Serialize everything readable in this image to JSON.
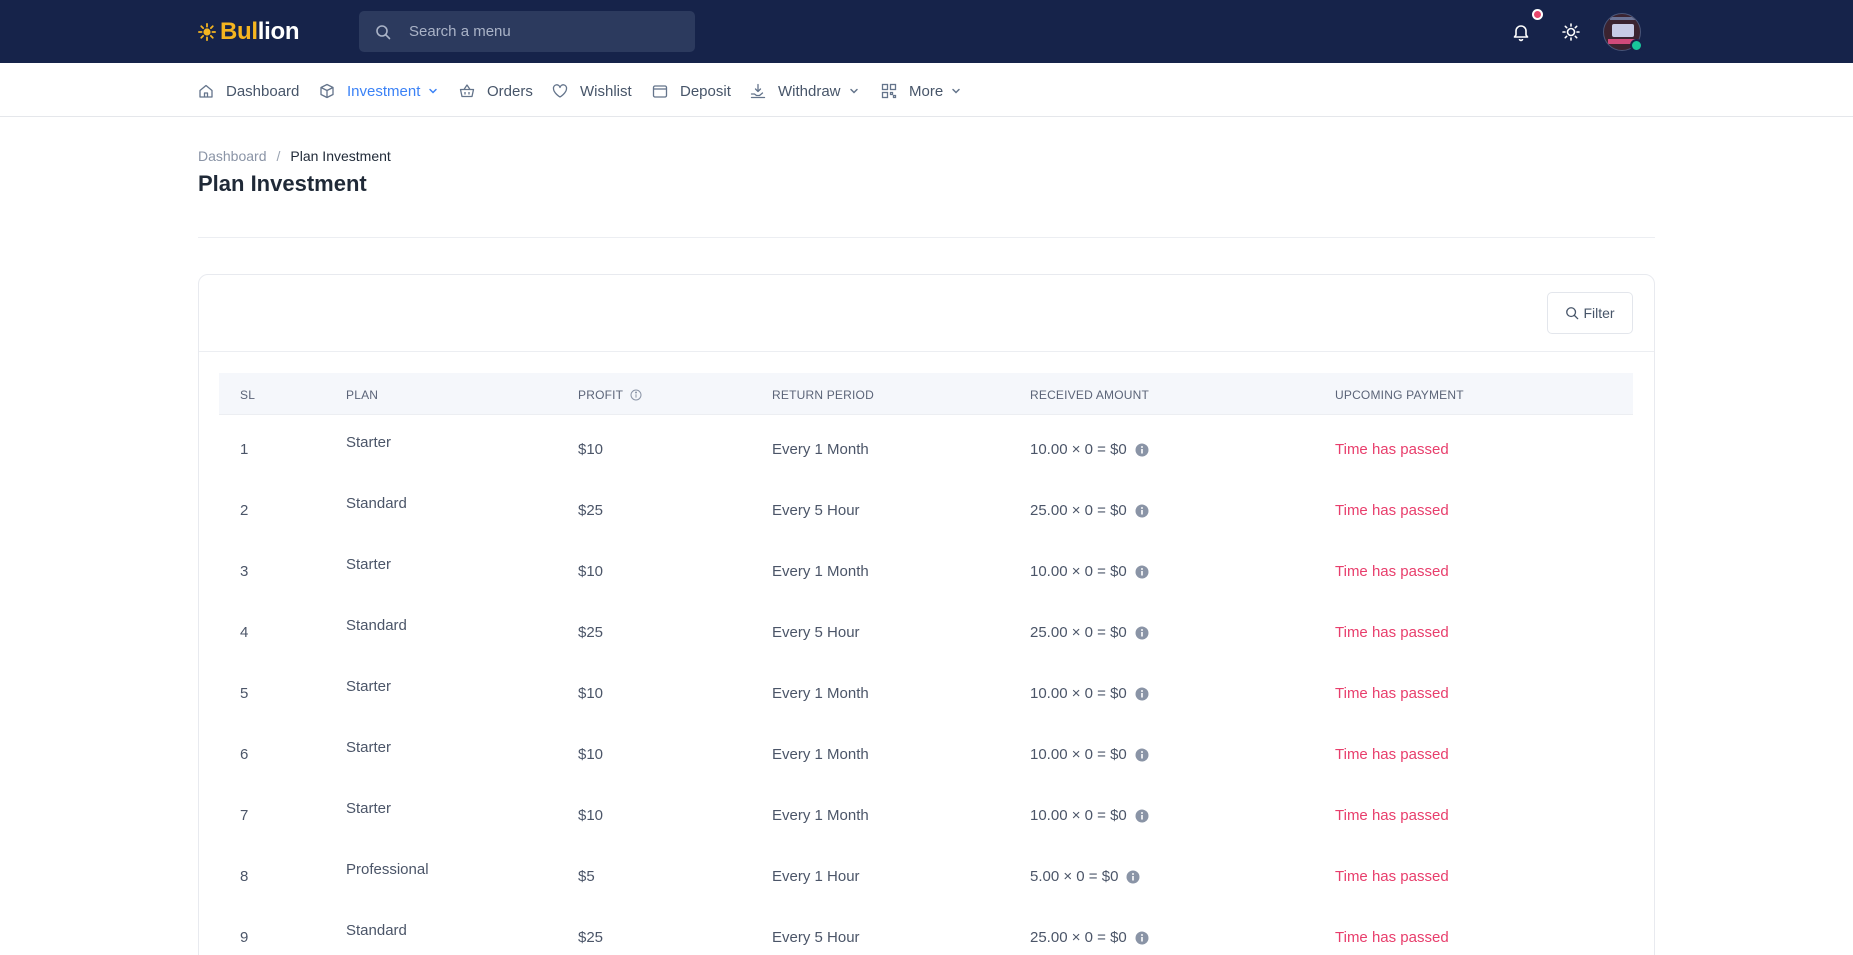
{
  "brand": {
    "part1": "B",
    "part2": "ul",
    "part3": "lion",
    "accent": "#f5b520"
  },
  "search": {
    "placeholder": "Search a menu"
  },
  "nav": {
    "items": [
      {
        "label": "Dashboard",
        "icon": "home-icon"
      },
      {
        "label": "Investment",
        "icon": "cube-icon",
        "active": true,
        "dropdown": true
      },
      {
        "label": "Orders",
        "icon": "basket-icon"
      },
      {
        "label": "Wishlist",
        "icon": "heart-icon"
      },
      {
        "label": "Deposit",
        "icon": "wallet-icon"
      },
      {
        "label": "Withdraw",
        "icon": "withdraw-icon",
        "dropdown": true
      },
      {
        "label": "More",
        "icon": "qr-icon",
        "dropdown": true
      }
    ]
  },
  "breadcrumb": {
    "parent": "Dashboard",
    "separator": "/",
    "current": "Plan Investment"
  },
  "page": {
    "title": "Plan Investment"
  },
  "filter": {
    "label": "Filter"
  },
  "table": {
    "columns": [
      "SL",
      "PLAN",
      "PROFIT",
      "RETURN PERIOD",
      "RECEIVED AMOUNT",
      "UPCOMING PAYMENT"
    ],
    "rows": [
      {
        "sl": "1",
        "plan": "Starter",
        "profit": "$10",
        "period": "Every 1 Month",
        "received": "10.00 × 0 = $0",
        "upcoming": "Time has passed"
      },
      {
        "sl": "2",
        "plan": "Standard",
        "profit": "$25",
        "period": "Every 5 Hour",
        "received": "25.00 × 0 = $0",
        "upcoming": "Time has passed"
      },
      {
        "sl": "3",
        "plan": "Starter",
        "profit": "$10",
        "period": "Every 1 Month",
        "received": "10.00 × 0 = $0",
        "upcoming": "Time has passed"
      },
      {
        "sl": "4",
        "plan": "Standard",
        "profit": "$25",
        "period": "Every 5 Hour",
        "received": "25.00 × 0 = $0",
        "upcoming": "Time has passed"
      },
      {
        "sl": "5",
        "plan": "Starter",
        "profit": "$10",
        "period": "Every 1 Month",
        "received": "10.00 × 0 = $0",
        "upcoming": "Time has passed"
      },
      {
        "sl": "6",
        "plan": "Starter",
        "profit": "$10",
        "period": "Every 1 Month",
        "received": "10.00 × 0 = $0",
        "upcoming": "Time has passed"
      },
      {
        "sl": "7",
        "plan": "Starter",
        "profit": "$10",
        "period": "Every 1 Month",
        "received": "10.00 × 0 = $0",
        "upcoming": "Time has passed"
      },
      {
        "sl": "8",
        "plan": "Professional",
        "profit": "$5",
        "period": "Every 1 Hour",
        "received": "5.00 × 0 = $0",
        "upcoming": "Time has passed"
      },
      {
        "sl": "9",
        "plan": "Standard",
        "profit": "$25",
        "period": "Every 5 Hour",
        "received": "25.00 × 0 = $0",
        "upcoming": "Time has passed"
      }
    ]
  },
  "colors": {
    "topbar": "#16234a",
    "active": "#3b82f6",
    "danger": "#e83e6c",
    "online": "#18c59b"
  }
}
